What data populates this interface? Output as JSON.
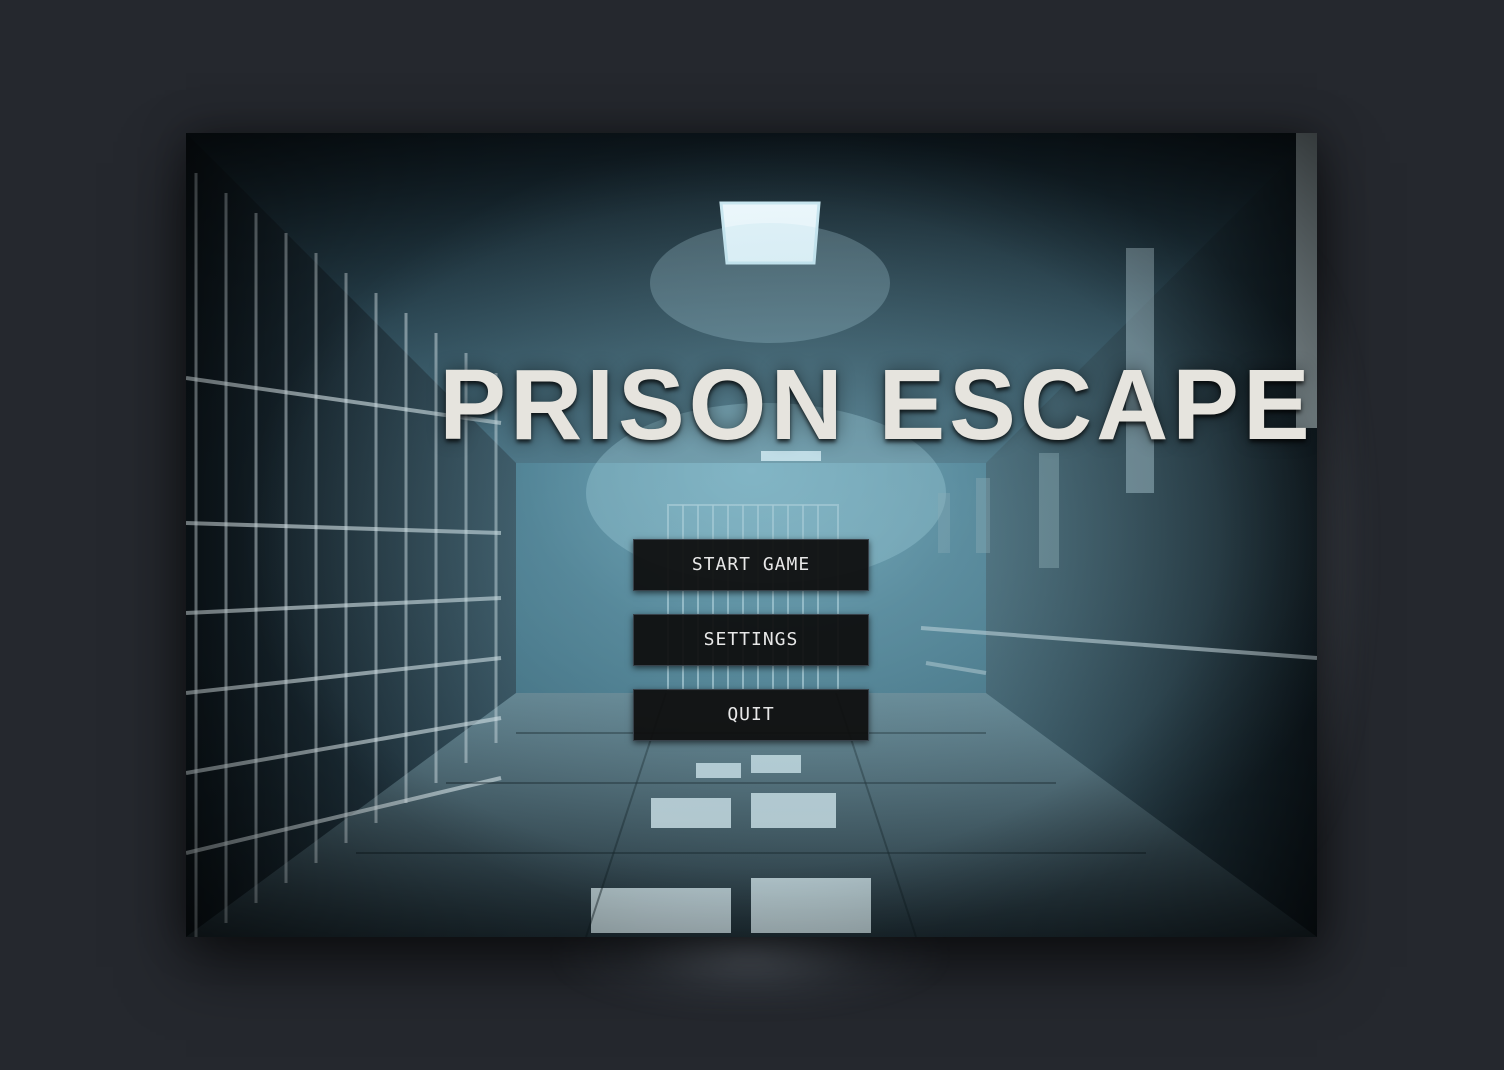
{
  "game": {
    "title": "PRISON ESCAPE"
  },
  "menu": {
    "items": [
      {
        "label": "START GAME"
      },
      {
        "label": "SETTINGS"
      },
      {
        "label": "QUIT"
      }
    ]
  },
  "colors": {
    "page_background": "#25282e",
    "button_background": "#0e0e0e",
    "title_text": "#e6e4de",
    "scene_tint": "#4f8aa0"
  }
}
